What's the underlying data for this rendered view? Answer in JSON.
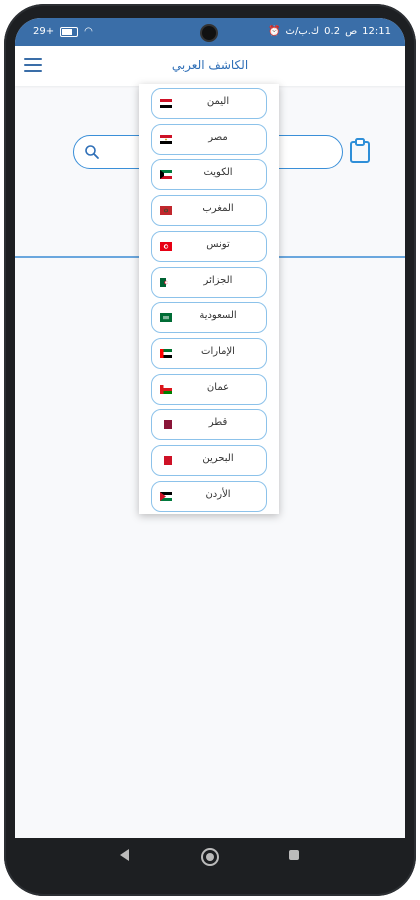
{
  "status_bar": {
    "time": "12:11",
    "period": "ص",
    "speed": "0.2",
    "speed_unit": "ك.ب/ث",
    "battery": "29+",
    "accent": "#3a6ea8"
  },
  "app_bar": {
    "title": "الكاشف العربي",
    "menu_icon": "hamburger-menu-icon"
  },
  "search": {
    "placeholder": "",
    "icon": "search-icon",
    "clipboard_icon": "clipboard-icon"
  },
  "countries": [
    {
      "name": "اليمن",
      "flag": "yemen"
    },
    {
      "name": "مصر",
      "flag": "egypt"
    },
    {
      "name": "الكويت",
      "flag": "kuwait"
    },
    {
      "name": "المغرب",
      "flag": "morocco"
    },
    {
      "name": "تونس",
      "flag": "tunisia"
    },
    {
      "name": "الجزائر",
      "flag": "algeria"
    },
    {
      "name": "السعودية",
      "flag": "saudi-arabia"
    },
    {
      "name": "الإمارات",
      "flag": "uae"
    },
    {
      "name": "عمان",
      "flag": "oman"
    },
    {
      "name": "قطر",
      "flag": "qatar"
    },
    {
      "name": "البحرين",
      "flag": "bahrain"
    },
    {
      "name": "الأردن",
      "flag": "jordan"
    }
  ],
  "colors": {
    "primary": "#2f6fb7",
    "border": "#8cc2ea",
    "search_border": "#3a8fd8"
  }
}
